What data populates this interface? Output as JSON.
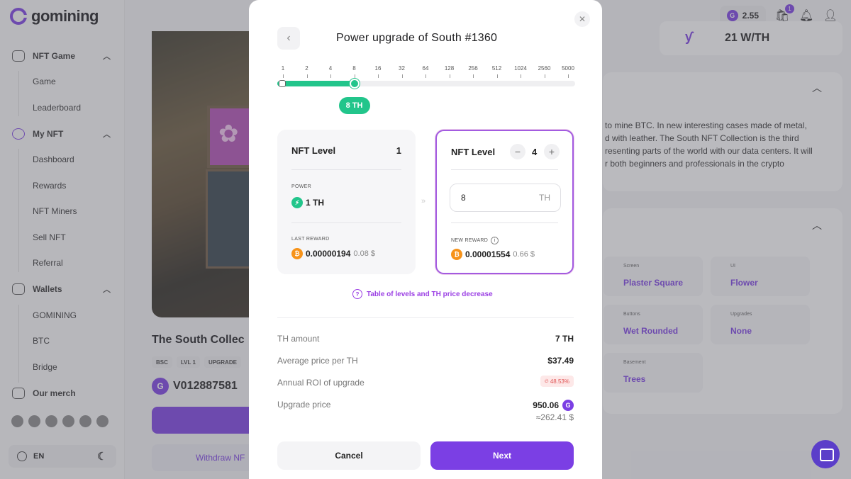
{
  "brand": {
    "name": "gomining",
    "accent": "#7b3fe4"
  },
  "sidebar": {
    "groups": [
      {
        "label": "NFT Game",
        "icon": "gamepad-icon",
        "items": [
          "Game",
          "Leaderboard"
        ]
      },
      {
        "label": "My NFT",
        "icon": "nft-icon",
        "items": [
          "Dashboard",
          "Rewards",
          "NFT Miners",
          "Sell NFT",
          "Referral"
        ]
      },
      {
        "label": "Wallets",
        "icon": "wallet-icon",
        "items": [
          "GOMINING",
          "BTC",
          "Bridge"
        ]
      }
    ],
    "merch": "Our merch",
    "language": "EN"
  },
  "topbar": {
    "balance": "2.55",
    "cart_badge": "1"
  },
  "background": {
    "nft_title": "The South Collec",
    "chips": [
      "BSC",
      "LVL 1",
      "UPGRADE"
    ],
    "address": "V012887581",
    "withdraw_label": "Withdraw NF",
    "efficiency": "21 W/TH",
    "description_lines": [
      "to mine BTC. In new interesting cases made of metal,",
      "d with leather. The South NFT Collection is the third",
      "resenting parts of the world with our data centers. It will",
      "r both beginners and professionals in the crypto"
    ],
    "traits": [
      {
        "label": "Screen",
        "value": "Plaster Square"
      },
      {
        "label": "UI",
        "value": "Flower"
      },
      {
        "label": "Buttons",
        "value": "Wet Rounded"
      },
      {
        "label": "Upgrades",
        "value": "None"
      },
      {
        "label": "Basement",
        "value": "Trees"
      }
    ]
  },
  "modal": {
    "title": "Power upgrade of South #1360",
    "scale_labels": [
      "1",
      "2",
      "4",
      "8",
      "16",
      "32",
      "64",
      "128",
      "256",
      "512",
      "1024",
      "2560",
      "5000"
    ],
    "selected_index": 3,
    "selected_label": "8 TH",
    "current": {
      "heading": "NFT Level",
      "level": "1",
      "power_caption": "POWER",
      "power": "1 TH",
      "reward_caption": "LAST REWARD",
      "reward_btc": "0.00000194",
      "reward_usd": "0.08 $"
    },
    "upgrade": {
      "heading": "NFT Level",
      "level": "4",
      "th_value": "8",
      "th_unit": "TH",
      "reward_caption": "NEW REWARD",
      "reward_btc": "0.00001554",
      "reward_usd": "0.66 $"
    },
    "levels_link": "Table of levels and TH price decrease",
    "summary": {
      "th_amount_label": "TH amount",
      "th_amount": "7 TH",
      "avg_price_label": "Average price per TH",
      "avg_price": "$37.49",
      "roi_label": "Annual ROI of upgrade",
      "roi": "48.53%",
      "price_label": "Upgrade price",
      "price": "950.06",
      "price_usd": "≈262.41 $"
    },
    "cancel_label": "Cancel",
    "next_label": "Next"
  }
}
